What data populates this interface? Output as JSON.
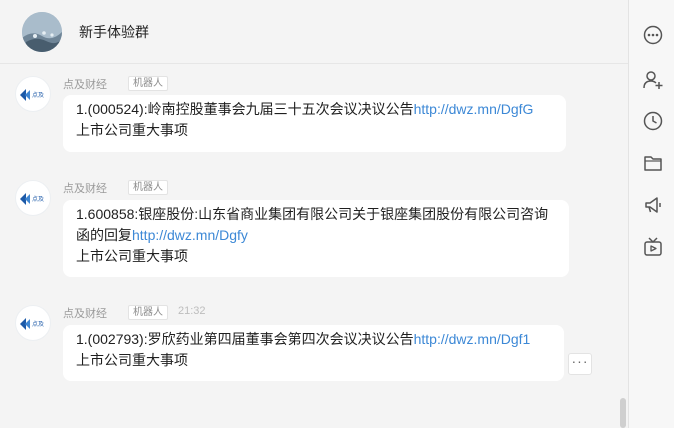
{
  "header": {
    "title": "新手体验群"
  },
  "messages": [
    {
      "sender": "点及财经",
      "bot_tag": "机器人",
      "time": "",
      "line1_text": "1.(000524):岭南控股董事会九届三十五次会议决议公告",
      "line1_link": "http://dwz.mn/DgfG",
      "line2_text": "",
      "line2_link": "",
      "line3_text": "上市公司重大事项"
    },
    {
      "sender": "点及财经",
      "bot_tag": "机器人",
      "time": "",
      "line1_text": "1.600858:银座股份:山东省商业集团有限公司关于银座集团股份有限公司咨询",
      "line1_link": "",
      "line2_text": "函的回复",
      "line2_link": "http://dwz.mn/Dgfy",
      "line3_text": "上市公司重大事项"
    },
    {
      "sender": "点及财经",
      "bot_tag": "机器人",
      "time": "21:32",
      "line1_text": "1.(002793):罗欣药业第四届董事会第四次会议决议公告",
      "line1_link": "http://dwz.mn/Dgf1",
      "line2_text": "",
      "line2_link": "",
      "line3_text": "上市公司重大事项"
    }
  ],
  "more_button": {
    "label": "···"
  },
  "sidebar": {
    "icons": [
      "more-options-icon",
      "add-member-icon",
      "history-clock-icon",
      "folder-icon",
      "announcement-icon",
      "live-tv-icon"
    ]
  },
  "colors": {
    "link": "#3c88d6",
    "background": "#f4f4f4",
    "bubble": "#ffffff"
  }
}
